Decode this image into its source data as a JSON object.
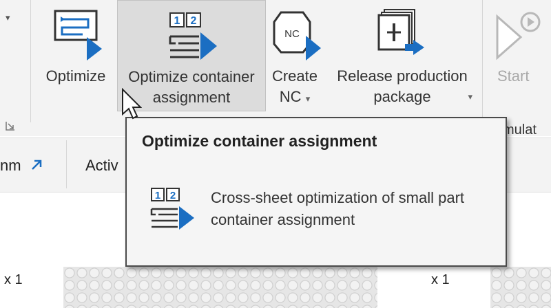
{
  "ribbon": {
    "buttons": [
      {
        "label1": "Optimize",
        "label2": ""
      },
      {
        "label1": "Optimize container",
        "label2": "assignment"
      },
      {
        "label1": "Create",
        "label2": "NC"
      },
      {
        "label1": "Release production",
        "label2": "package"
      },
      {
        "label1": "Start",
        "label2": ""
      }
    ],
    "dropdown_glyph": "▾",
    "partial_group_label": "mulat",
    "icons": [
      "optimize-icon",
      "optimize-container-icon",
      "create-nc-icon",
      "release-package-icon",
      "start-icon",
      "dialog-launcher-icon"
    ]
  },
  "toolbar": {
    "item1": "nm",
    "item2": "Activ"
  },
  "rows": {
    "left_count": "x 1",
    "right_count": "x 1"
  },
  "tooltip": {
    "title": "Optimize container assignment",
    "description": "Cross-sheet optimization of small part container assignment",
    "icon_badge_1": "1",
    "icon_badge_2": "2"
  },
  "nc_badge": "NC",
  "colors": {
    "accent": "#1b6ec2",
    "ribbon_bg": "#f3f3f3",
    "highlight": "#dcdcdc"
  }
}
